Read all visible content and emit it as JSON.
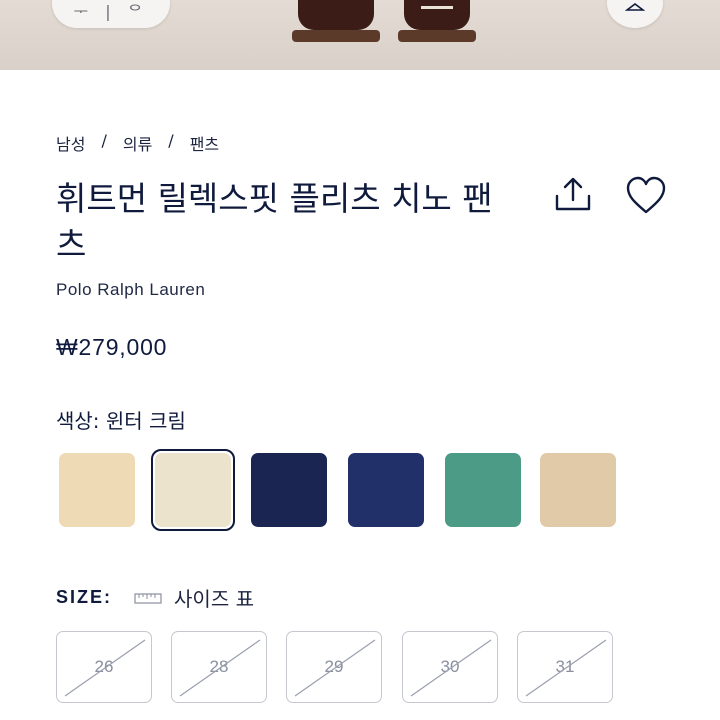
{
  "hero": {
    "pill_glyph": "ᅮ | ᄋ"
  },
  "breadcrumb": [
    "남성",
    "의류",
    "팬츠"
  ],
  "breadcrumb_separator": "/",
  "product": {
    "title": "휘트먼 릴렉스핏 플리츠 치노 팬츠",
    "brand": "Polo Ralph Lauren",
    "price": "₩279,000"
  },
  "color": {
    "label": "색상: 윈터 크림",
    "swatches": [
      {
        "hex": "#eedbb5",
        "selected": false
      },
      {
        "hex": "#ece3cc",
        "selected": true
      },
      {
        "hex": "#1a2552",
        "selected": false
      },
      {
        "hex": "#223069",
        "selected": false
      },
      {
        "hex": "#4b9b86",
        "selected": false
      },
      {
        "hex": "#e0caa8",
        "selected": false
      }
    ]
  },
  "size": {
    "label": "SIZE:",
    "chart_label": "사이즈 표",
    "options": [
      {
        "label": "26",
        "available": false
      },
      {
        "label": "28",
        "available": false
      },
      {
        "label": "29",
        "available": false
      },
      {
        "label": "30",
        "available": false
      },
      {
        "label": "31",
        "available": false
      }
    ]
  },
  "colors": {
    "navy": "#0f1a3c",
    "border": "#c6c8d0",
    "disabled_text": "#8a8f9e"
  },
  "icons": [
    "share-icon",
    "heart-icon",
    "ruler-icon",
    "hanger-icon"
  ]
}
